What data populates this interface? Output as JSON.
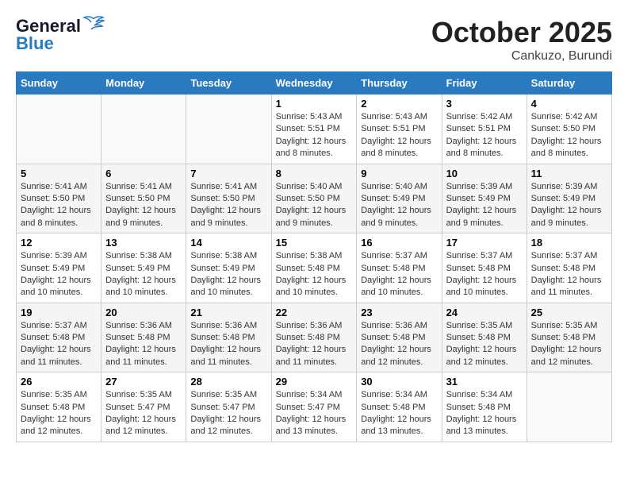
{
  "header": {
    "logo_line1": "General",
    "logo_line2": "Blue",
    "month": "October 2025",
    "location": "Cankuzo, Burundi"
  },
  "weekdays": [
    "Sunday",
    "Monday",
    "Tuesday",
    "Wednesday",
    "Thursday",
    "Friday",
    "Saturday"
  ],
  "weeks": [
    [
      {
        "day": "",
        "info": ""
      },
      {
        "day": "",
        "info": ""
      },
      {
        "day": "",
        "info": ""
      },
      {
        "day": "1",
        "info": "Sunrise: 5:43 AM\nSunset: 5:51 PM\nDaylight: 12 hours\nand 8 minutes."
      },
      {
        "day": "2",
        "info": "Sunrise: 5:43 AM\nSunset: 5:51 PM\nDaylight: 12 hours\nand 8 minutes."
      },
      {
        "day": "3",
        "info": "Sunrise: 5:42 AM\nSunset: 5:51 PM\nDaylight: 12 hours\nand 8 minutes."
      },
      {
        "day": "4",
        "info": "Sunrise: 5:42 AM\nSunset: 5:50 PM\nDaylight: 12 hours\nand 8 minutes."
      }
    ],
    [
      {
        "day": "5",
        "info": "Sunrise: 5:41 AM\nSunset: 5:50 PM\nDaylight: 12 hours\nand 8 minutes."
      },
      {
        "day": "6",
        "info": "Sunrise: 5:41 AM\nSunset: 5:50 PM\nDaylight: 12 hours\nand 9 minutes."
      },
      {
        "day": "7",
        "info": "Sunrise: 5:41 AM\nSunset: 5:50 PM\nDaylight: 12 hours\nand 9 minutes."
      },
      {
        "day": "8",
        "info": "Sunrise: 5:40 AM\nSunset: 5:50 PM\nDaylight: 12 hours\nand 9 minutes."
      },
      {
        "day": "9",
        "info": "Sunrise: 5:40 AM\nSunset: 5:49 PM\nDaylight: 12 hours\nand 9 minutes."
      },
      {
        "day": "10",
        "info": "Sunrise: 5:39 AM\nSunset: 5:49 PM\nDaylight: 12 hours\nand 9 minutes."
      },
      {
        "day": "11",
        "info": "Sunrise: 5:39 AM\nSunset: 5:49 PM\nDaylight: 12 hours\nand 9 minutes."
      }
    ],
    [
      {
        "day": "12",
        "info": "Sunrise: 5:39 AM\nSunset: 5:49 PM\nDaylight: 12 hours\nand 10 minutes."
      },
      {
        "day": "13",
        "info": "Sunrise: 5:38 AM\nSunset: 5:49 PM\nDaylight: 12 hours\nand 10 minutes."
      },
      {
        "day": "14",
        "info": "Sunrise: 5:38 AM\nSunset: 5:49 PM\nDaylight: 12 hours\nand 10 minutes."
      },
      {
        "day": "15",
        "info": "Sunrise: 5:38 AM\nSunset: 5:48 PM\nDaylight: 12 hours\nand 10 minutes."
      },
      {
        "day": "16",
        "info": "Sunrise: 5:37 AM\nSunset: 5:48 PM\nDaylight: 12 hours\nand 10 minutes."
      },
      {
        "day": "17",
        "info": "Sunrise: 5:37 AM\nSunset: 5:48 PM\nDaylight: 12 hours\nand 10 minutes."
      },
      {
        "day": "18",
        "info": "Sunrise: 5:37 AM\nSunset: 5:48 PM\nDaylight: 12 hours\nand 11 minutes."
      }
    ],
    [
      {
        "day": "19",
        "info": "Sunrise: 5:37 AM\nSunset: 5:48 PM\nDaylight: 12 hours\nand 11 minutes."
      },
      {
        "day": "20",
        "info": "Sunrise: 5:36 AM\nSunset: 5:48 PM\nDaylight: 12 hours\nand 11 minutes."
      },
      {
        "day": "21",
        "info": "Sunrise: 5:36 AM\nSunset: 5:48 PM\nDaylight: 12 hours\nand 11 minutes."
      },
      {
        "day": "22",
        "info": "Sunrise: 5:36 AM\nSunset: 5:48 PM\nDaylight: 12 hours\nand 11 minutes."
      },
      {
        "day": "23",
        "info": "Sunrise: 5:36 AM\nSunset: 5:48 PM\nDaylight: 12 hours\nand 12 minutes."
      },
      {
        "day": "24",
        "info": "Sunrise: 5:35 AM\nSunset: 5:48 PM\nDaylight: 12 hours\nand 12 minutes."
      },
      {
        "day": "25",
        "info": "Sunrise: 5:35 AM\nSunset: 5:48 PM\nDaylight: 12 hours\nand 12 minutes."
      }
    ],
    [
      {
        "day": "26",
        "info": "Sunrise: 5:35 AM\nSunset: 5:48 PM\nDaylight: 12 hours\nand 12 minutes."
      },
      {
        "day": "27",
        "info": "Sunrise: 5:35 AM\nSunset: 5:47 PM\nDaylight: 12 hours\nand 12 minutes."
      },
      {
        "day": "28",
        "info": "Sunrise: 5:35 AM\nSunset: 5:47 PM\nDaylight: 12 hours\nand 12 minutes."
      },
      {
        "day": "29",
        "info": "Sunrise: 5:34 AM\nSunset: 5:47 PM\nDaylight: 12 hours\nand 13 minutes."
      },
      {
        "day": "30",
        "info": "Sunrise: 5:34 AM\nSunset: 5:48 PM\nDaylight: 12 hours\nand 13 minutes."
      },
      {
        "day": "31",
        "info": "Sunrise: 5:34 AM\nSunset: 5:48 PM\nDaylight: 12 hours\nand 13 minutes."
      },
      {
        "day": "",
        "info": ""
      }
    ]
  ]
}
